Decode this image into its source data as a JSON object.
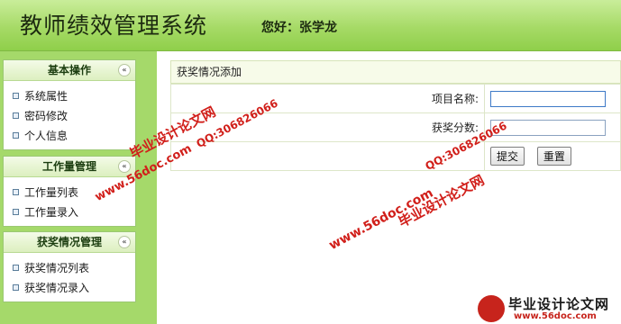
{
  "header": {
    "title": "教师绩效管理系统",
    "greeting": "您好：张学龙"
  },
  "sidebar": {
    "panels": [
      {
        "title": "基本操作",
        "items": [
          "系统属性",
          "密码修改",
          "个人信息"
        ]
      },
      {
        "title": "工作量管理",
        "items": [
          "工作量列表",
          "工作量录入"
        ]
      },
      {
        "title": "获奖情况管理",
        "items": [
          "获奖情况列表",
          "获奖情况录入"
        ]
      }
    ],
    "collapse_glyph": "«"
  },
  "form": {
    "title": "获奖情况添加",
    "fields": [
      {
        "label": "项目名称:",
        "value": ""
      },
      {
        "label": "获奖分数:",
        "value": ""
      }
    ],
    "submit_label": "提交",
    "reset_label": "重置"
  },
  "watermark": {
    "site_name": "毕业设计论文网",
    "qq": "QQ:306826066",
    "url": "www.56doc.com",
    "logo_text": "毕业设计论文网",
    "logo_url": "www.56doc.com"
  },
  "colors": {
    "header_green": "#a6da66",
    "sidebar_green": "#a5d96a",
    "watermark_red": "#d11f1a"
  }
}
